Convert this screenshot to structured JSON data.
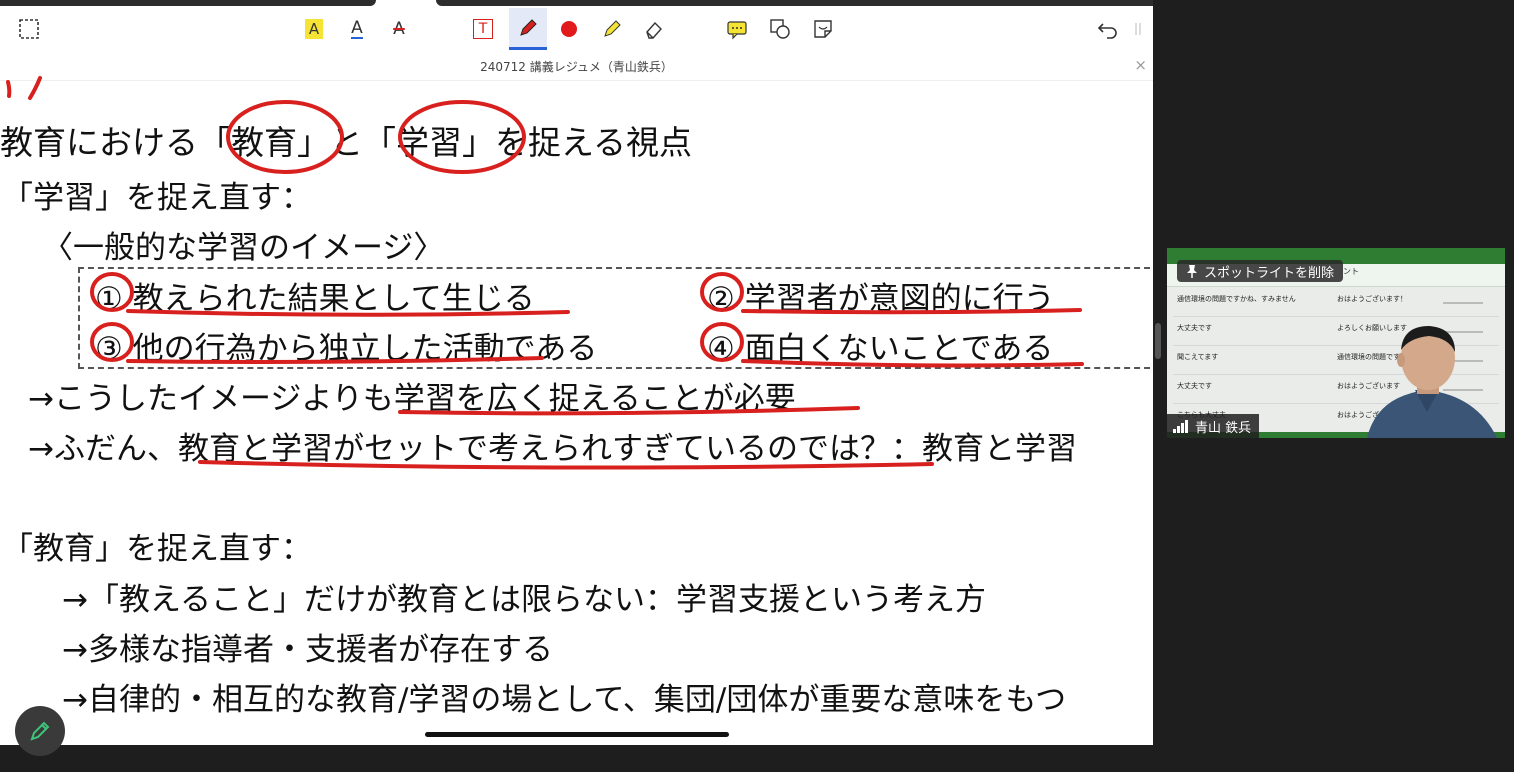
{
  "document": {
    "title": "240712 講義レジュメ（青山鉄兵）",
    "lines": [
      "教育における「教育」と「学習」を捉える視点",
      "「学習」を捉え直す：",
      "〈一般的な学習のイメージ〉",
      "① 教えられた結果として生じる",
      "② 学習者が意図的に行う",
      "③ 他の行為から独立した活動である",
      "④ 面白くないことである",
      "→こうしたイメージよりも学習を広く捉えることが必要",
      "→ふだん、教育と学習がセットで考えられすぎているのでは？：教育と学習",
      "「教育」を捉え直す：",
      "→「教えること」だけが教育とは限らない：学習支援という考え方",
      "→多様な指導者・支援者が存在する",
      "→自律的・相互的な教育/学習の場として、集団/団体が重要な意味をもつ"
    ]
  },
  "toolbar": {
    "tools": [
      "selection-tool",
      "highlight-text-tool",
      "underline-text-tool",
      "strikethrough-text-tool",
      "text-box-tool",
      "pen-tool",
      "color-red",
      "highlighter-tool",
      "eraser-tool",
      "comment-tool",
      "shapes-tool",
      "sticker-tool",
      "undo",
      "more"
    ],
    "highlight_glyph": "A",
    "underline_glyph": "A",
    "strike_glyph": "A",
    "text_glyph": "T"
  },
  "colors": {
    "ink": "#d8211e",
    "accent": "#2962d6",
    "highlight": "#f5e433"
  },
  "video": {
    "spotlight_label": "スポットライトを削除",
    "participant_name": "青山 鉄兵",
    "header_right": "ント",
    "rows": [
      {
        "c1": "通信環境の問題ですかね、すみません",
        "c2": "おはようございます！"
      },
      {
        "c1": "大丈夫です",
        "c2": "よろしくお願いします"
      },
      {
        "c1": "聞こえてます",
        "c2": "通信環境の問題ですか"
      },
      {
        "c1": "大丈夫です",
        "c2": "おはようございます"
      },
      {
        "c1": "こちらも大丈夫",
        "c2": "おはようございます"
      }
    ]
  }
}
